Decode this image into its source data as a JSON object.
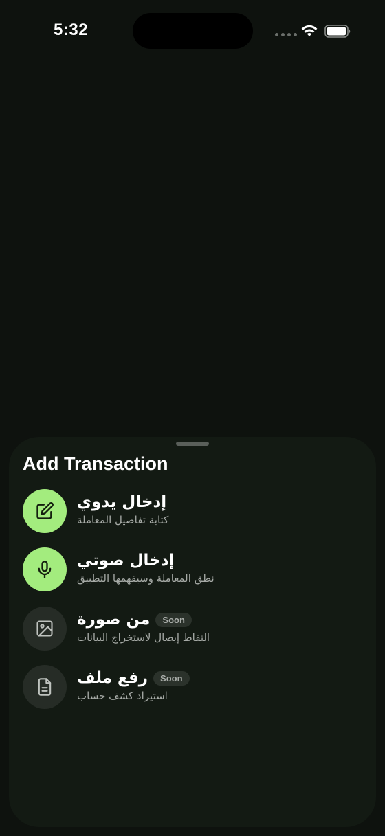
{
  "status_bar": {
    "time": "5:32"
  },
  "sheet": {
    "title": "Add Transaction",
    "options": [
      {
        "title": "إدخال يدوي",
        "subtitle": "كتابة تفاصيل المعاملة",
        "icon": "edit-icon",
        "enabled": true,
        "badge": ""
      },
      {
        "title": "إدخال صوتي",
        "subtitle": "نطق المعاملة وسيفهمها التطبيق",
        "icon": "microphone-icon",
        "enabled": true,
        "badge": ""
      },
      {
        "title": "من صورة",
        "subtitle": "التقاط إيصال لاستخراج البيانات",
        "icon": "image-icon",
        "enabled": false,
        "badge": "Soon"
      },
      {
        "title": "رفع ملف",
        "subtitle": "استيراد كشف حساب",
        "icon": "document-icon",
        "enabled": false,
        "badge": "Soon"
      }
    ]
  },
  "colors": {
    "background": "#0e120e",
    "sheet": "#131a13",
    "accent": "#a3ec7e",
    "disabled_icon_bg": "#262c26",
    "badge_bg": "#2b322b"
  }
}
